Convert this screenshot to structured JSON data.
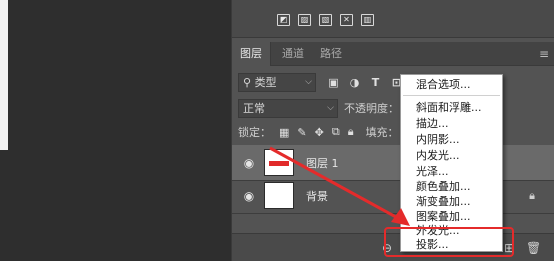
{
  "tabs": {
    "layers": "图层",
    "channels": "通道",
    "paths": "路径"
  },
  "filter": {
    "kind": "类型"
  },
  "blend": {
    "mode": "正常",
    "opacity_label": "不透明度："
  },
  "lock": {
    "label": "锁定：",
    "fill_label": "填充："
  },
  "layers": [
    {
      "name": "图层 1",
      "selected": true
    },
    {
      "name": "背景",
      "selected": false
    }
  ],
  "menu": {
    "items": [
      "混合选项...",
      "斜面和浮雕...",
      "描边...",
      "内阴影...",
      "内发光...",
      "光泽...",
      "颜色叠加...",
      "渐变叠加...",
      "图案叠加...",
      "外发光...",
      "投影..."
    ]
  },
  "colors": {
    "annotation": "#e42b2b",
    "panel_bg": "#535353",
    "menu_bg": "#ffffff"
  },
  "icons": {
    "adjustments": [
      "levels-icon",
      "curves-icon",
      "exposure-icon",
      "vibrance-icon",
      "hue-icon",
      "gradient-map-icon",
      "selective-color-icon",
      "threshold-icon",
      "invert-icon",
      "posterize-icon"
    ],
    "filters": [
      "pixel-filter-icon",
      "adjustment-filter-icon",
      "type-filter-icon",
      "shape-filter-icon"
    ],
    "lock": [
      "lock-transparent-icon",
      "lock-image-icon",
      "lock-position-icon",
      "lock-artboard-icon",
      "lock-all-icon"
    ],
    "footer": [
      "link-icon",
      "fx-icon",
      "mask-icon",
      "adjustment-icon",
      "group-icon",
      "new-layer-icon",
      "trash-icon"
    ]
  }
}
